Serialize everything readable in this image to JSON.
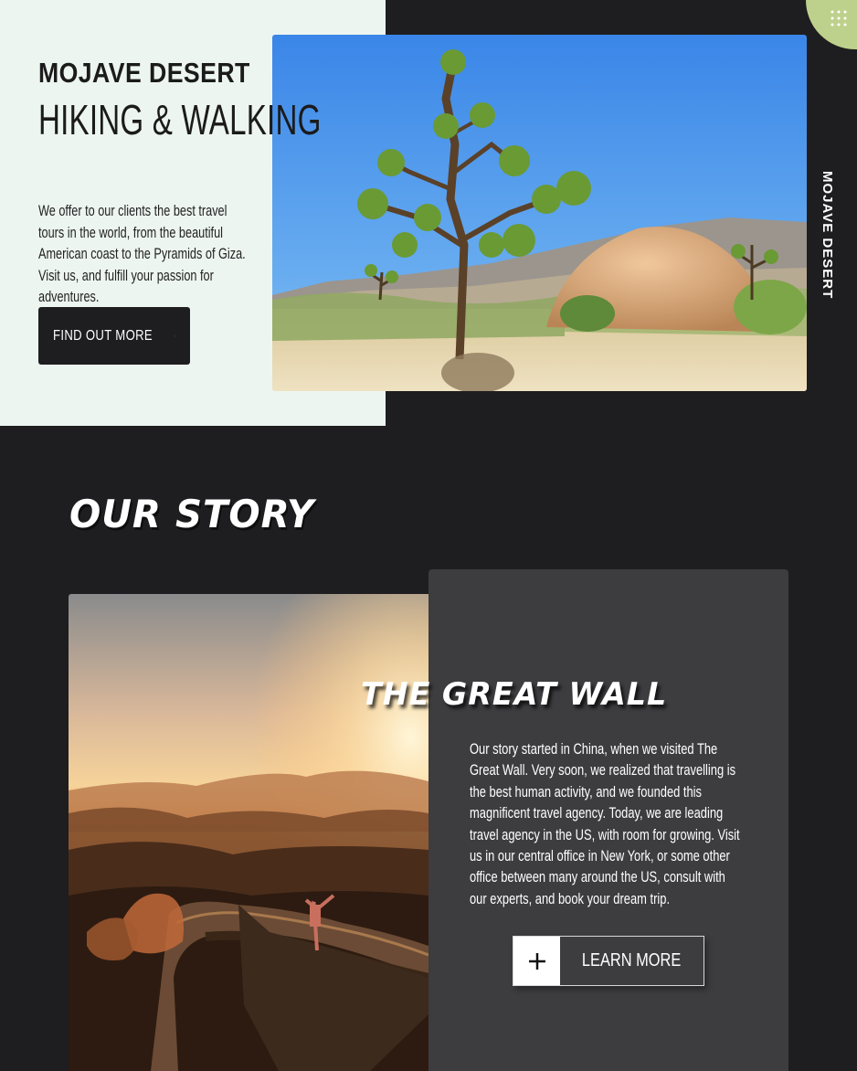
{
  "hero": {
    "title": "MOJAVE DESERT",
    "subtitle": "HIKING & WALKING",
    "description": "We offer to our clients the best travel tours in the world, from the beautiful American coast to the Pyramids of Giza. Visit us, and fulfill your passion for adventures.",
    "button_label": "FIND OUT MORE",
    "side_label": "MOJAVE DESERT"
  },
  "story": {
    "heading": "OUR STORY",
    "card_title": "THE GREAT WALL",
    "card_body": "Our story started in China, when we visited The Great Wall. Very soon, we realized that travelling is the best human activity, and we founded this magnificent travel agency. Today, we are leading travel agency in the US, with room for growing. Visit us in our central office in New York, or some other office between many around the US, consult with our experts, and book your dream trip.",
    "button_label": "LEARN MORE"
  },
  "icons": {
    "hero_button": "chevron-right-icon",
    "story_button": "plus-icon",
    "corner_badge": "dots-grid-icon"
  },
  "colors": {
    "background": "#1e1d1f",
    "hero_panel": "#edf5f1",
    "card": "#3d3c3f",
    "accent": "#bed18c"
  }
}
